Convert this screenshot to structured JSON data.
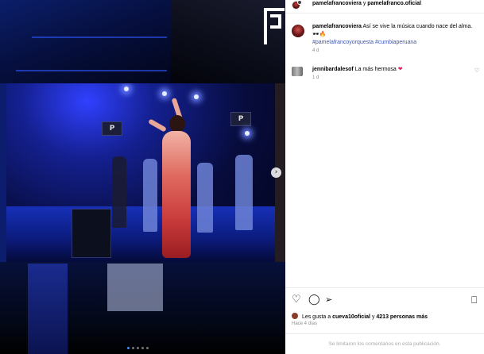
{
  "post": {
    "header": {
      "user1": "pamelafrancoviera",
      "joiner": "y",
      "user2": "pamelafranco.oficial"
    },
    "caption": {
      "text": "Así se vive la música cuando nace del alma. 🕶️🔥",
      "hashtags": "#pamelafrancoyorquesta #cumbiaperuana",
      "age": "4 d"
    },
    "comments": [
      {
        "username": "jennibardalesof",
        "text": "La más hermosa",
        "emoji": "❤",
        "age": "1 d"
      }
    ],
    "likes": {
      "prefix": "Les gusta a",
      "user": "cueva10oficial",
      "connector": "y",
      "count": "4213 personas más"
    },
    "posted": "Hace 4 días",
    "comments_disabled": "Se limitaron los comentarios en esta publicación."
  },
  "media": {
    "stage_screen_label": "P",
    "carousel_dots": 5,
    "active_dot": 0
  },
  "icons": {
    "like": "heart-outline-icon",
    "comment": "comment-bubble-icon",
    "share": "paper-plane-icon",
    "save": "bookmark-icon",
    "next": "chevron-right-icon"
  },
  "colors": {
    "hashtag": "#3a55b5",
    "heart": "#e0245e",
    "meta": "#8e8e8e"
  }
}
